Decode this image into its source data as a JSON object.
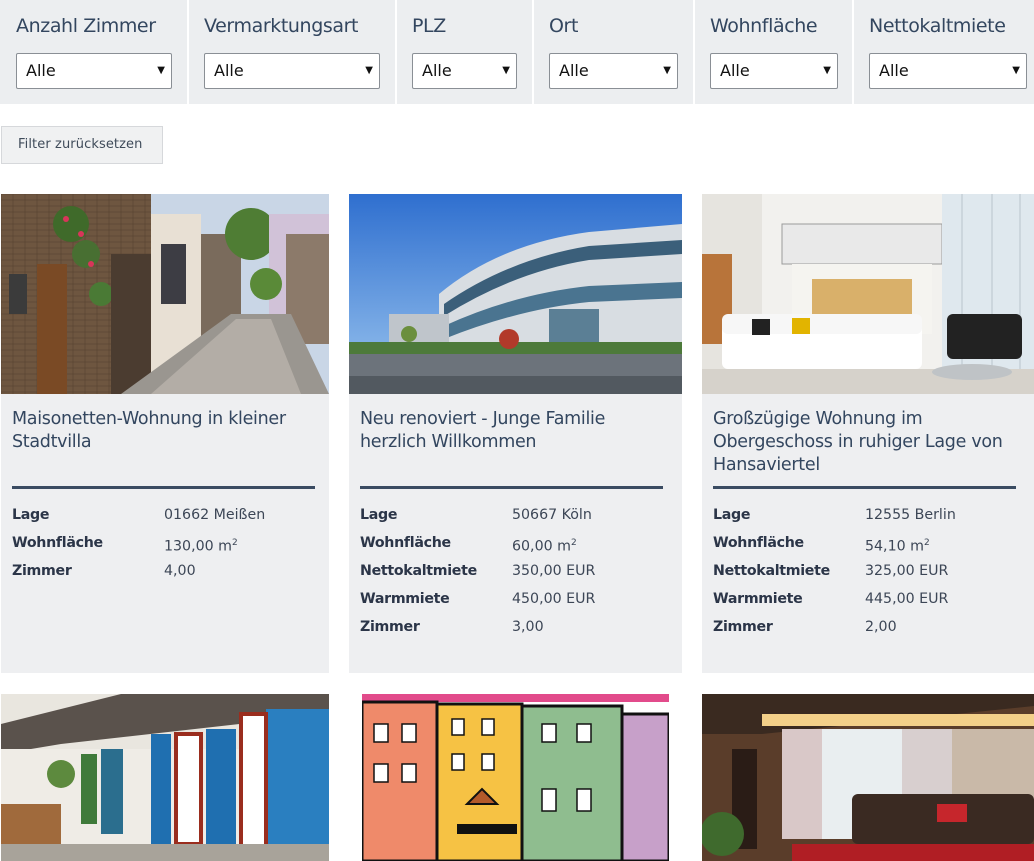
{
  "filters": [
    {
      "label": "Anzahl Zimmer",
      "value": "Alle"
    },
    {
      "label": "Vermarktungsart",
      "value": "Alle"
    },
    {
      "label": "PLZ",
      "value": "Alle"
    },
    {
      "label": "Ort",
      "value": "Alle"
    },
    {
      "label": "Wohnfläche",
      "value": "Alle"
    },
    {
      "label": "Nettokaltmiete",
      "value": "Alle"
    }
  ],
  "reset_label": "Filter zurücksetzen",
  "listings": [
    {
      "title": "Maisonetten-Wohnung in kleiner Stadtvilla",
      "rows": [
        {
          "label": "Lage",
          "value": "01662 Meißen"
        },
        {
          "label": "Wohnfläche",
          "value": "130,00 m",
          "unit_sup": "2"
        },
        {
          "label": "Zimmer",
          "value": "4,00"
        }
      ]
    },
    {
      "title": "Neu renoviert - Junge Familie herzlich Willkommen",
      "rows": [
        {
          "label": "Lage",
          "value": "50667 Köln"
        },
        {
          "label": "Wohnfläche",
          "value": "60,00 m",
          "unit_sup": "2"
        },
        {
          "label": "Nettokaltmiete",
          "value": "350,00 EUR"
        },
        {
          "label": "Warmmiete",
          "value": "450,00 EUR"
        },
        {
          "label": "Zimmer",
          "value": "3,00"
        }
      ]
    },
    {
      "title": "Großzügige Wohnung im Obergeschoss in ruhiger Lage von Hansaviertel",
      "rows": [
        {
          "label": "Lage",
          "value": "12555 Berlin"
        },
        {
          "label": "Wohnfläche",
          "value": "54,10 m",
          "unit_sup": "2"
        },
        {
          "label": "Nettokaltmiete",
          "value": "325,00 EUR"
        },
        {
          "label": "Warmmiete",
          "value": "445,00 EUR"
        },
        {
          "label": "Zimmer",
          "value": "2,00"
        }
      ]
    }
  ],
  "select_arrow": "▾"
}
